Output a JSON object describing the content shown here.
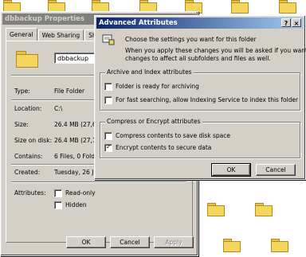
{
  "properties_window": {
    "title": "dbbackup Properties",
    "tabs": [
      "General",
      "Web Sharing",
      "Sharin"
    ],
    "folder_name": "dbbackup",
    "rows": [
      {
        "label": "Type:",
        "value": "File Folder"
      },
      {
        "label": "Location:",
        "value": "C:\\"
      },
      {
        "label": "Size:",
        "value": "26.4 MB (27,68"
      },
      {
        "label": "Size on disk:",
        "value": "26.4 MB (27,70"
      },
      {
        "label": "Contains:",
        "value": "6 Files, 0 Folder"
      },
      {
        "label": "Created:",
        "value": "Tuesday, 26 Ju"
      }
    ],
    "attributes_label": "Attributes:",
    "readonly_label": "Read-only",
    "hidden_label": "Hidden",
    "buttons": {
      "ok": "OK",
      "cancel": "Cancel",
      "apply": "Apply"
    }
  },
  "advanced_dialog": {
    "title": "Advanced Attributes",
    "help_button": "?",
    "close_button": "×",
    "intro_line1": "Choose the settings you want for this folder",
    "intro_line2": "When you apply these changes you will be asked if you want the",
    "intro_line3": "changes to affect all subfolders and files as well.",
    "archive_group_title": "Archive and Index attributes",
    "archive_label": "Folder is ready for archiving",
    "index_label": "For fast searching, allow Indexing Service to index this folder",
    "compress_group_title": "Compress or Encrypt attributes",
    "compress_label": "Compress contents to save disk space",
    "encrypt_label": "Encrypt contents to secure data",
    "archive_checked": false,
    "index_checked": false,
    "compress_checked": false,
    "encrypt_checked": true,
    "ok": "OK",
    "cancel": "Cancel"
  }
}
